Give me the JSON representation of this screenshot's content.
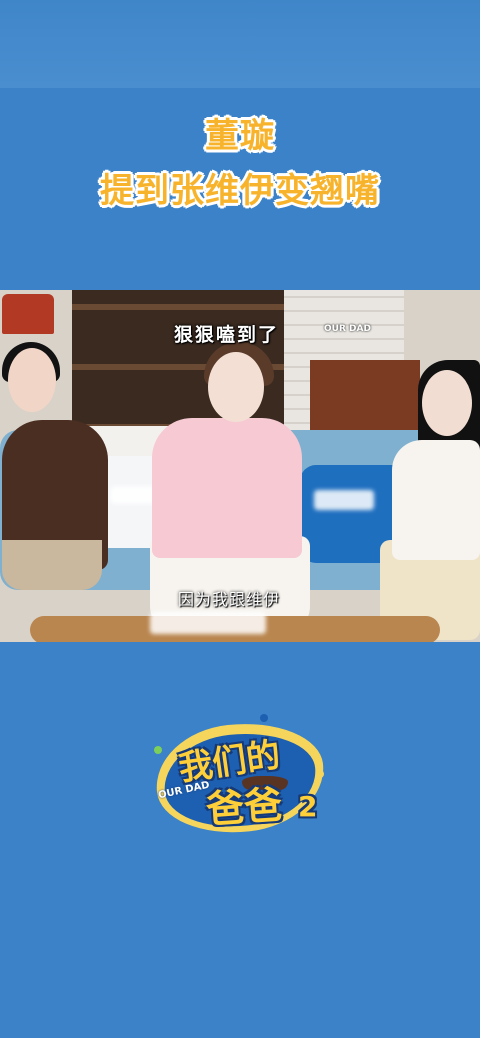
{
  "headline": {
    "line1": "董璇",
    "line2": "提到张维伊变翘嘴"
  },
  "video": {
    "subtitle_top": "狠狠嗑到了",
    "watermark": "OUR DAD",
    "subtitle_bottom": "因为我跟维伊"
  },
  "show_logo": {
    "title_line1": "我们的",
    "title_line2": "爸爸",
    "english": "OUR DAD",
    "season": "2"
  },
  "colors": {
    "background": "#3b82c8",
    "headline": "#f7b32b",
    "logo_yellow": "#ffcf3a"
  }
}
